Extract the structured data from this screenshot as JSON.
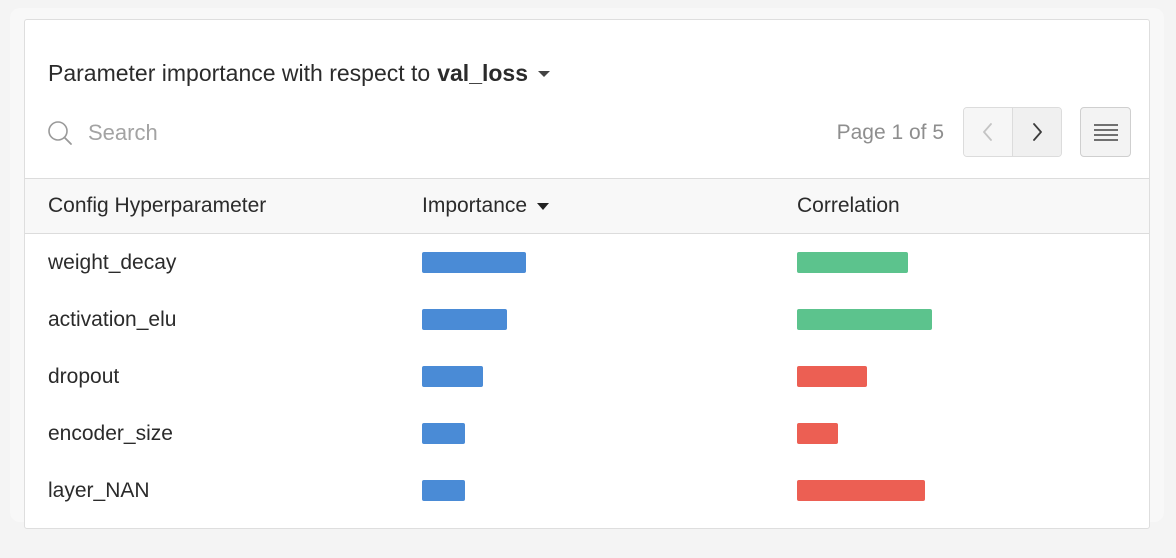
{
  "title": {
    "prefix": "Parameter importance with respect to",
    "metric": "val_loss"
  },
  "search": {
    "placeholder": "Search",
    "value": ""
  },
  "pagination": {
    "text": "Page 1 of 5",
    "current": 1,
    "total": 5
  },
  "icons": {
    "search": "search-icon",
    "prev": "chevron-left-icon",
    "next": "chevron-right-icon",
    "menu": "hamburger-menu-icon",
    "sort": "caret-down-icon"
  },
  "colors": {
    "importance": "#4a8bd6",
    "positive_correlation": "#5cc38d",
    "negative_correlation": "#ec5f53"
  },
  "table": {
    "columns": {
      "hyperparameter": "Config Hyperparameter",
      "importance": "Importance",
      "correlation": "Correlation"
    },
    "sorted_by": "Importance",
    "rows": [
      {
        "name": "weight_decay",
        "importance": 0.56,
        "correlation": 0.6
      },
      {
        "name": "activation_elu",
        "importance": 0.46,
        "correlation": 0.73
      },
      {
        "name": "dropout",
        "importance": 0.33,
        "correlation": -0.38
      },
      {
        "name": "encoder_size",
        "importance": 0.23,
        "correlation": -0.22
      },
      {
        "name": "layer_NAN",
        "importance": 0.23,
        "correlation": -0.69
      }
    ]
  }
}
